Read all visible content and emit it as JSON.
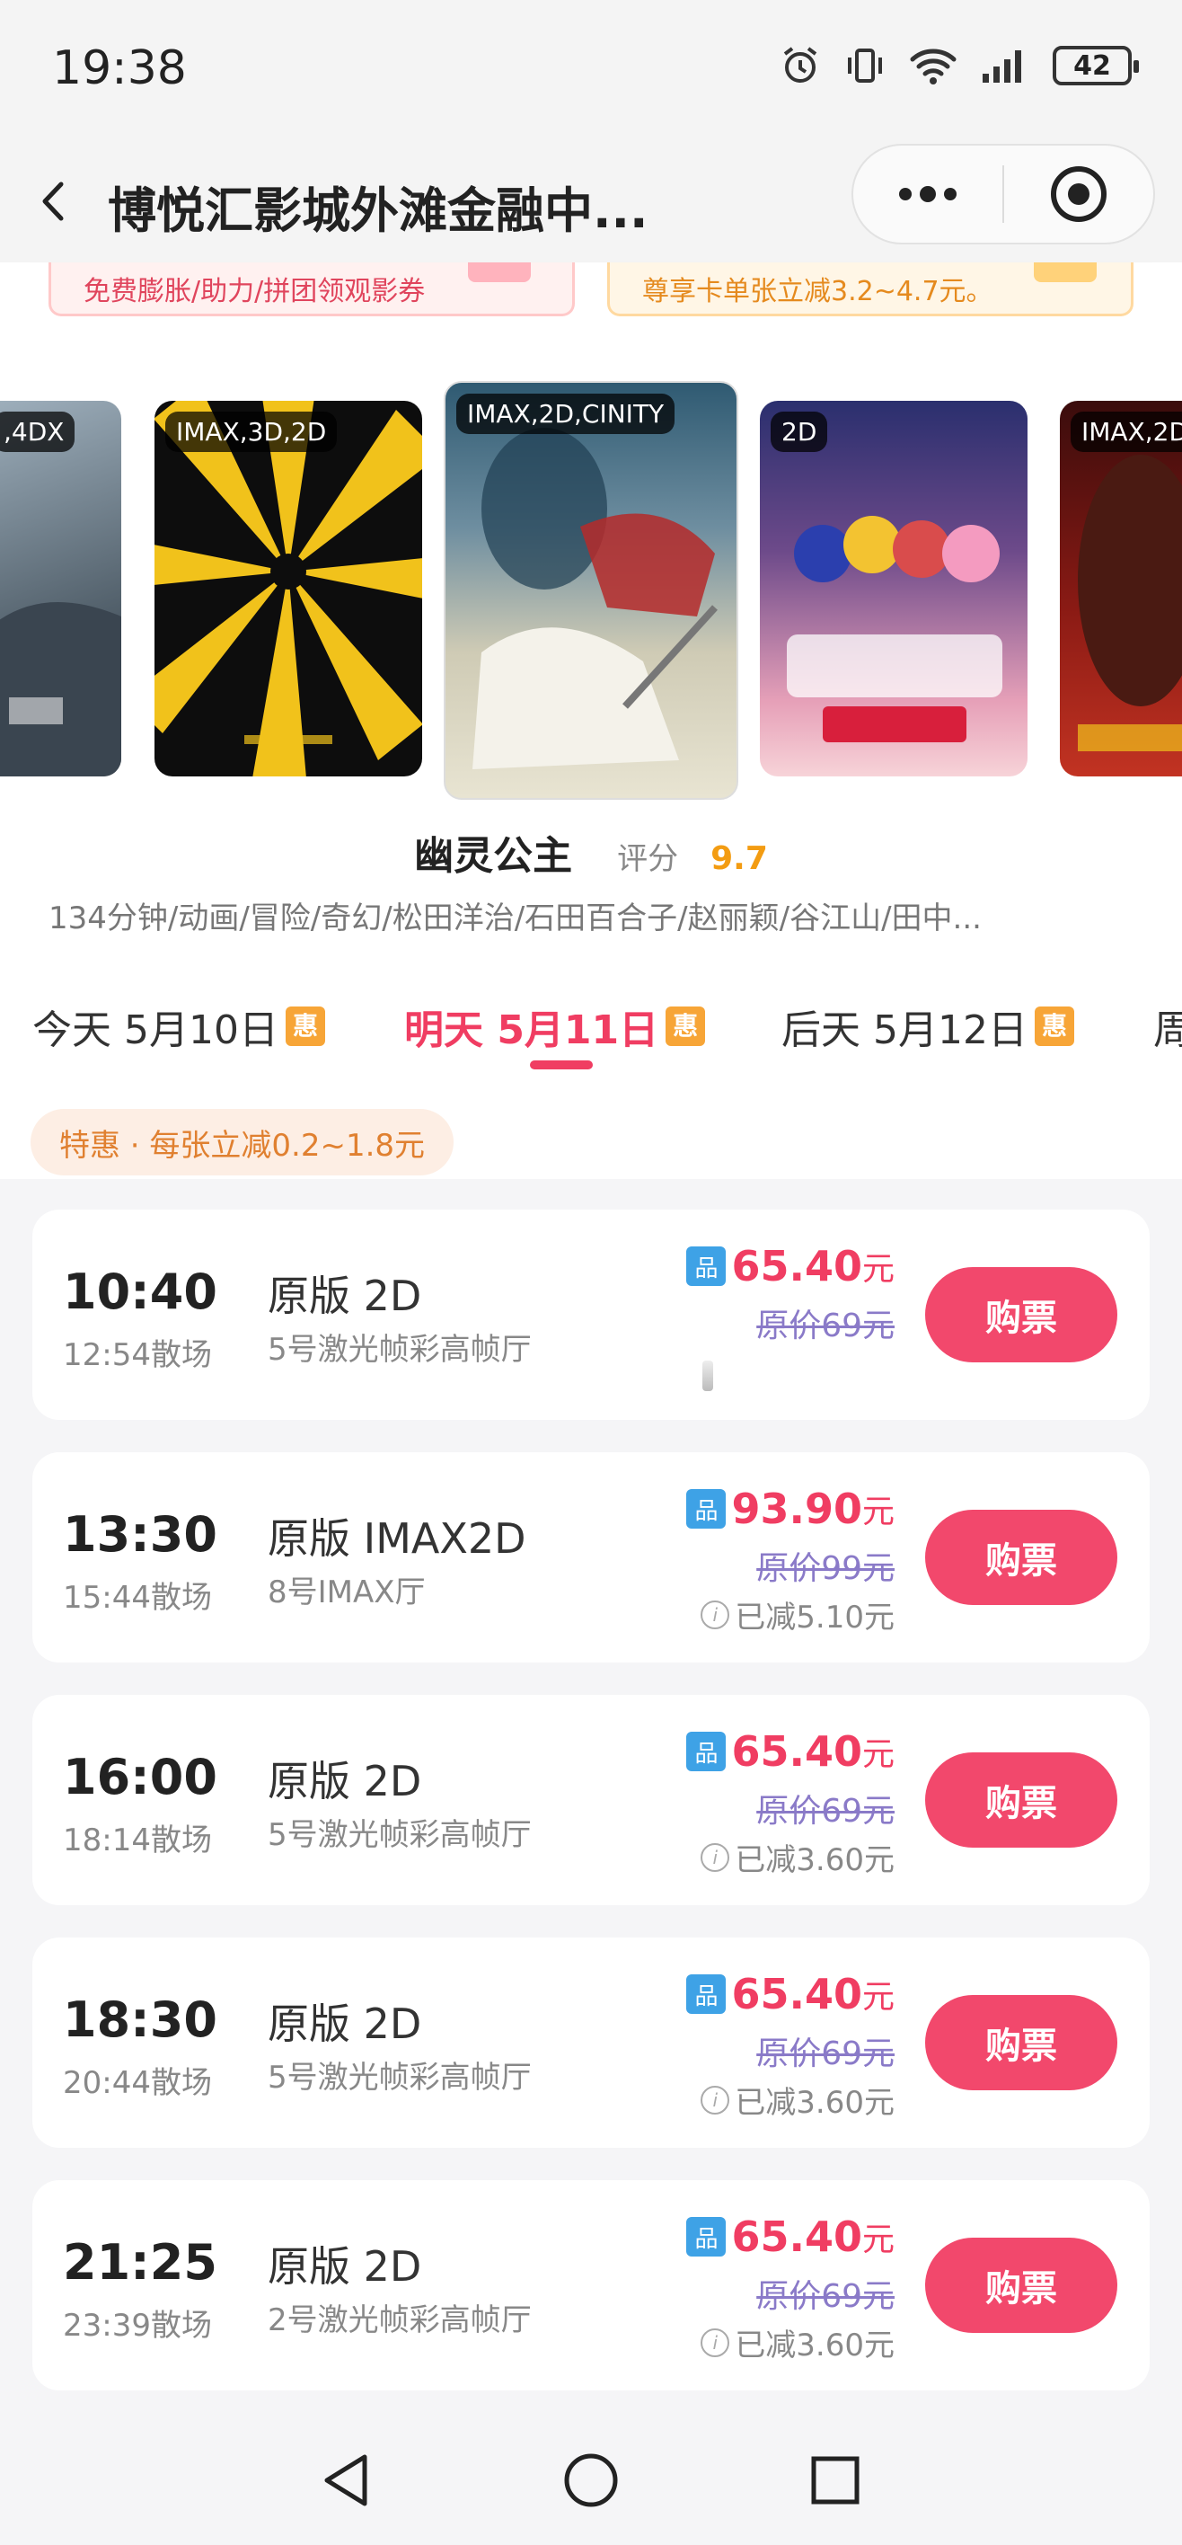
{
  "status_bar": {
    "time": "19:38",
    "battery": "42"
  },
  "nav": {
    "title": "博悦汇影城外滩金融中..."
  },
  "promos": [
    {
      "text": "免费膨胀/助力/拼团领观影券"
    },
    {
      "text": "尊享卡单张立减3.2~4.7元。"
    }
  ],
  "posters": [
    {
      "tag": ",4DX"
    },
    {
      "tag": "IMAX,3D,2D"
    },
    {
      "tag": "IMAX,2D,CINITY"
    },
    {
      "tag": "2D"
    },
    {
      "tag": "IMAX,2D"
    }
  ],
  "movie": {
    "title": "幽灵公主",
    "rating_label": "评分",
    "rating": "9.7",
    "meta": "134分钟/动画/冒险/奇幻/松田洋治/石田百合子/赵丽颖/谷江山/田中..."
  },
  "dates": [
    {
      "label": "今天 5月10日",
      "badge": "惠",
      "active": false
    },
    {
      "label": "明天 5月11日",
      "badge": "惠",
      "active": true
    },
    {
      "label": "后天 5月12日",
      "badge": "惠",
      "active": false
    },
    {
      "label": "周",
      "badge": "",
      "active": false
    }
  ],
  "discount_tip": "特惠 · 每张立减0.2~1.8元",
  "showtimes": [
    {
      "start": "10:40",
      "end": "12:54散场",
      "version": "原版 2D",
      "hall": "5号激光帧彩高帧厅",
      "badge": "品",
      "price": "65.40",
      "unit": "元",
      "original": "原价69元",
      "discount": "",
      "buy": "购票"
    },
    {
      "start": "13:30",
      "end": "15:44散场",
      "version": "原版 IMAX2D",
      "hall": "8号IMAX厅",
      "badge": "品",
      "price": "93.90",
      "unit": "元",
      "original": "原价99元",
      "discount": "已减5.10元",
      "buy": "购票"
    },
    {
      "start": "16:00",
      "end": "18:14散场",
      "version": "原版 2D",
      "hall": "5号激光帧彩高帧厅",
      "badge": "品",
      "price": "65.40",
      "unit": "元",
      "original": "原价69元",
      "discount": "已减3.60元",
      "buy": "购票"
    },
    {
      "start": "18:30",
      "end": "20:44散场",
      "version": "原版 2D",
      "hall": "5号激光帧彩高帧厅",
      "badge": "品",
      "price": "65.40",
      "unit": "元",
      "original": "原价69元",
      "discount": "已减3.60元",
      "buy": "购票"
    },
    {
      "start": "21:25",
      "end": "23:39散场",
      "version": "原版 2D",
      "hall": "2号激光帧彩高帧厅",
      "badge": "品",
      "price": "65.40",
      "unit": "元",
      "original": "原价69元",
      "discount": "已减3.60元",
      "buy": "购票"
    }
  ],
  "colors": {
    "accent": "#f03d62",
    "buy_button": "#f2486c",
    "rating": "#f39c12",
    "hui_badge": "#f7a537",
    "pin_badge": "#3ea2e6"
  }
}
